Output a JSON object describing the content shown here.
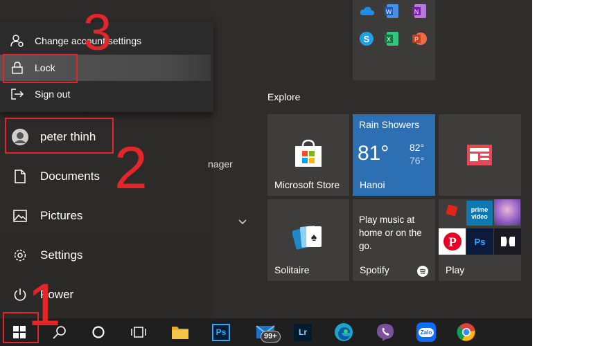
{
  "account_menu": {
    "change_settings": "Change account settings",
    "lock": "Lock",
    "sign_out": "Sign out"
  },
  "user": {
    "name": "peter thinh"
  },
  "nav": {
    "documents": "Documents",
    "pictures": "Pictures",
    "settings": "Settings",
    "power": "Power"
  },
  "partial_app_text": "nager",
  "explore_label": "Explore",
  "annotations": {
    "step1": "1",
    "step2": "2",
    "step3": "3"
  },
  "tiles": {
    "store": "Microsoft Store",
    "weather": {
      "condition": "Rain Showers",
      "temp": "81°",
      "high": "82°",
      "low": "76°",
      "city": "Hanoi"
    },
    "spotify": {
      "text": "Play music at home or on the go.",
      "label": "Spotify"
    },
    "solitaire": "Solitaire",
    "play": "Play",
    "prime_video": "prime video"
  },
  "taskbar": {
    "mail_badge": "99+",
    "ps": "Ps",
    "lr": "Lr",
    "zalo": "Zalo"
  },
  "colors": {
    "accent_red": "#e3262a",
    "weather_blue": "#2c6fb3",
    "taskbar": "#1f1f1f"
  }
}
